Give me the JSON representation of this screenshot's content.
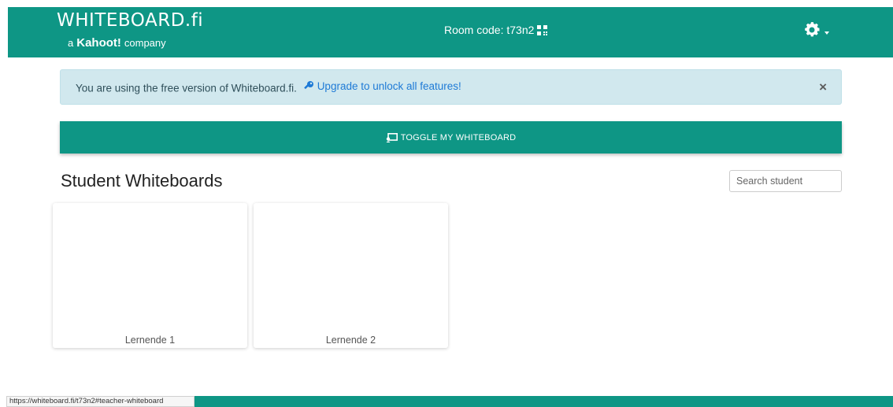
{
  "navbar": {
    "brand_logo": "WHITEBOARD.fi",
    "brand_sub_prefix": "a",
    "brand_sub_kahoot": "Kahoot!",
    "brand_sub_suffix": "company",
    "room_code": "Room code: t73n2",
    "settings_icon": "gear-icon",
    "color": "#0e9685"
  },
  "alert": {
    "text": "You are using the free version of Whiteboard.fi.",
    "link": "Upgrade to unlock all features!",
    "close": "×",
    "background": "#d1e8ee"
  },
  "toggle_button": {
    "label": "TOGGLE MY WHITEBOARD",
    "icon": "whiteboard-icon"
  },
  "main": {
    "heading": "Student Whiteboards",
    "search_placeholder": "Search student",
    "students": [
      {
        "name": "Lernende 1"
      },
      {
        "name": "Lernende 2"
      }
    ]
  },
  "status_bar": {
    "url": "https://whiteboard.fi/t73n2#teacher-whiteboard"
  }
}
